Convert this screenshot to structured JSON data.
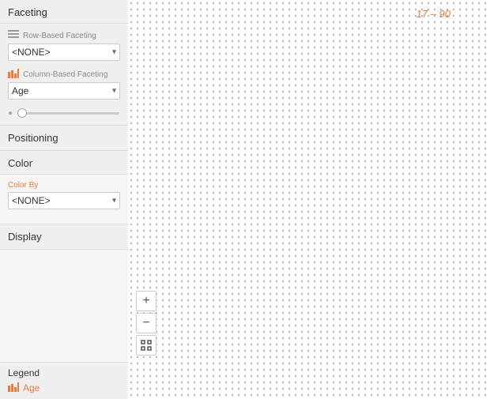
{
  "sidebar": {
    "faceting_title": "Faceting",
    "row_faceting_label": "Row-Based Faceting",
    "row_faceting_value": "<NONE>",
    "col_faceting_label": "Column-Based Faceting",
    "col_faceting_value": "Age",
    "slider_value": "1",
    "positioning_title": "Positioning",
    "color_title": "Color",
    "color_by_label": "Color By",
    "color_by_value": "<NONE>",
    "display_title": "Display",
    "legend_title": "Legend",
    "legend_item": "Age"
  },
  "chart": {
    "annotation": "17 – 90",
    "zoom_in_label": "+",
    "zoom_out_label": "−"
  },
  "select_options_none": [
    "<NONE>"
  ],
  "select_options_age": [
    "Age"
  ]
}
